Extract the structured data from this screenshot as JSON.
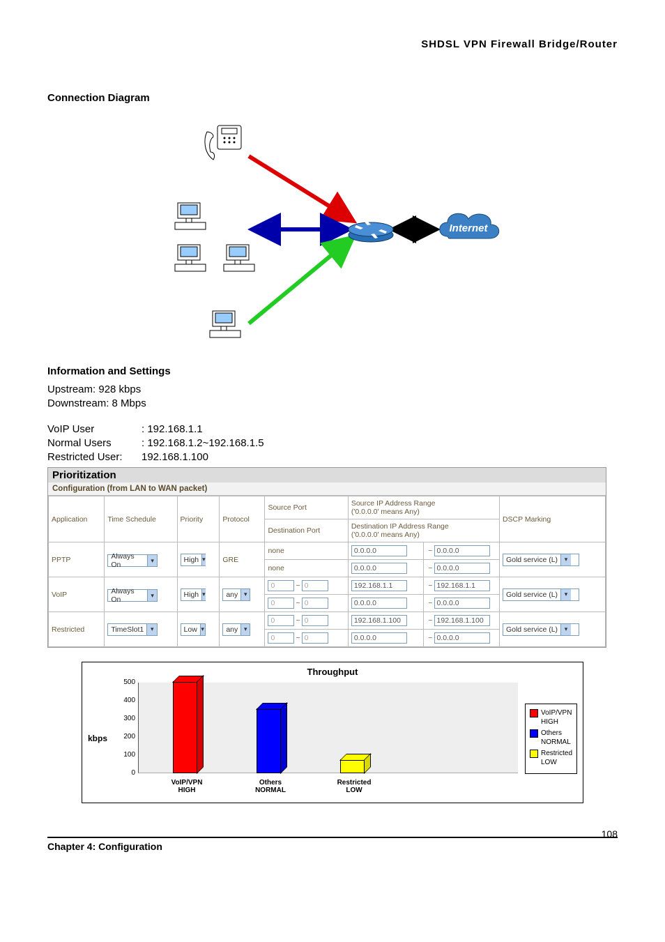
{
  "header": {
    "title": "SHDSL VPN Firewall Bridge/Router"
  },
  "sections": {
    "diagram_title": "Connection Diagram",
    "info_title": "Information and Settings"
  },
  "info": {
    "upstream": "Upstream: 928 kbps",
    "downstream": "Downstream: 8 Mbps",
    "users": [
      {
        "label": "VoIP User",
        "value": ": 192.168.1.1"
      },
      {
        "label": "Normal Users",
        "value": ": 192.168.1.2~192.168.1.5"
      },
      {
        "label": "Restricted User:",
        "value": "192.168.1.100"
      }
    ]
  },
  "diagram": {
    "internet_label": "Internet"
  },
  "panel": {
    "title": "Prioritization",
    "subtitle": "Configuration (from LAN to WAN packet)",
    "headers": {
      "application": "Application",
      "time_schedule": "Time Schedule",
      "priority": "Priority",
      "protocol": "Protocol",
      "src_port": "Source Port",
      "dst_port": "Destination Port",
      "src_ip": "Source IP Address Range",
      "dst_ip": "Destination IP Address Range",
      "ip_hint": "('0.0.0.0' means Any)",
      "dscp": "DSCP Marking"
    },
    "rows": [
      {
        "app": "PPTP",
        "schedule": "Always On",
        "priority": "High",
        "protocol": "GRE",
        "protocol_select": false,
        "src_port": "none",
        "dst_port": "none",
        "port_inputs": false,
        "src_ip_from": "0.0.0.0",
        "src_ip_to": "0.0.0.0",
        "dst_ip_from": "0.0.0.0",
        "dst_ip_to": "0.0.0.0",
        "dscp": "Gold service (L)"
      },
      {
        "app": "VoIP",
        "schedule": "Always On",
        "priority": "High",
        "protocol": "any",
        "protocol_select": true,
        "port_inputs": true,
        "src_port_from": "0",
        "src_port_to": "0",
        "dst_port_from": "0",
        "dst_port_to": "0",
        "src_ip_from": "192.168.1.1",
        "src_ip_to": "192.168.1.1",
        "dst_ip_from": "0.0.0.0",
        "dst_ip_to": "0.0.0.0",
        "dscp": "Gold service (L)"
      },
      {
        "app": "Restricted",
        "schedule": "TimeSlot1",
        "priority": "Low",
        "protocol": "any",
        "protocol_select": true,
        "port_inputs": true,
        "src_port_from": "0",
        "src_port_to": "0",
        "dst_port_from": "0",
        "dst_port_to": "0",
        "src_ip_from": "192.168.1.100",
        "src_ip_to": "192.168.1.100",
        "dst_ip_from": "0.0.0.0",
        "dst_ip_to": "0.0.0.0",
        "dscp": "Gold service (L)"
      }
    ]
  },
  "chart_data": {
    "type": "bar",
    "title": "Throughput",
    "ylabel": "kbps",
    "ylim": [
      0,
      500
    ],
    "yticks": [
      0,
      100,
      200,
      300,
      400,
      500
    ],
    "categories": [
      "VoIP/VPN\nHIGH",
      "Others\nNORMAL",
      "Restricted\nLOW"
    ],
    "values": [
      500,
      350,
      70
    ],
    "colors": [
      "#ff0000",
      "#0000ff",
      "#ffff00"
    ],
    "legend": [
      {
        "label": "VoIP/VPN\nHIGH",
        "color": "#ff0000"
      },
      {
        "label": "Others\nNORMAL",
        "color": "#0000ff"
      },
      {
        "label": "Restricted\nLOW",
        "color": "#ffff00"
      }
    ]
  },
  "footer": {
    "chapter": "Chapter 4: Configuration",
    "page": "108"
  }
}
